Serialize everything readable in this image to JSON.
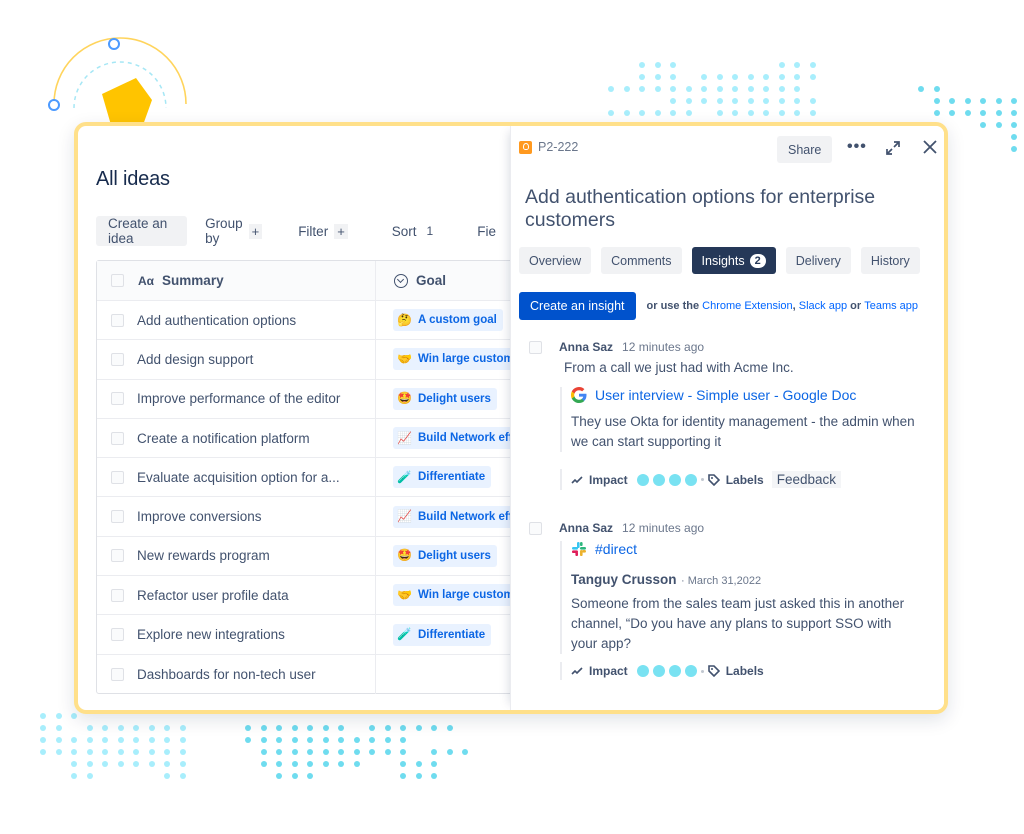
{
  "left_panel": {
    "title": "All ideas",
    "toolbar": {
      "create_label": "Create an idea",
      "group_by_label": "Group by",
      "group_by_add": "+",
      "filter_label": "Filter",
      "filter_add": "+",
      "sort_label": "Sort",
      "sort_count": "1",
      "fields_label": "Fie"
    },
    "table": {
      "columns": [
        {
          "icon": "text-type-icon",
          "icon_text": "Aα",
          "label": "Summary"
        },
        {
          "icon": "goal-icon",
          "label": "Goal"
        }
      ],
      "rows": [
        {
          "summary": "Add authentication options",
          "goal": "A custom goal",
          "goal_emoji": "🤔"
        },
        {
          "summary": "Add design support",
          "goal": "Win large customers",
          "goal_emoji": "🤝"
        },
        {
          "summary": "Improve performance of the editor",
          "goal": "Delight users",
          "goal_emoji": "🤩"
        },
        {
          "summary": "Create a notification platform",
          "goal": "Build Network effects",
          "goal_emoji": "📈"
        },
        {
          "summary": "Evaluate acquisition option for a...",
          "goal": "Differentiate",
          "goal_emoji": "🧪"
        },
        {
          "summary": "Improve conversions",
          "goal": "Build Network effects",
          "goal_emoji": "📈"
        },
        {
          "summary": "New rewards program",
          "goal": "Delight users",
          "goal_emoji": "🤩"
        },
        {
          "summary": "Refactor user profile data",
          "goal": "Win large customers",
          "goal_emoji": "🤝"
        },
        {
          "summary": "Explore new integrations",
          "goal": "Differentiate",
          "goal_emoji": "🧪"
        },
        {
          "summary": "Dashboards for non-tech user",
          "goal": "",
          "goal_emoji": ""
        }
      ]
    }
  },
  "detail_panel": {
    "issue_key": "P2-222",
    "issue_icon": "lightbulb-icon",
    "share_label": "Share",
    "more_label": "•••",
    "title": "Add authentication options for enterprise customers",
    "tabs": [
      {
        "label": "Overview",
        "active": false
      },
      {
        "label": "Comments",
        "active": false
      },
      {
        "label": "Insights",
        "active": true,
        "badge": "2"
      },
      {
        "label": "Delivery",
        "active": false
      },
      {
        "label": "History",
        "active": false
      }
    ],
    "create_insight_label": "Create an insight",
    "create_hint": {
      "prefix": "or use the",
      "link1": "Chrome Extension",
      "comma": ",",
      "link2": "Slack app",
      "or": "or",
      "link3": "Teams app"
    },
    "insights": [
      {
        "author": "Anna Saz",
        "time": "12 minutes ago",
        "note": "From a call we just had with Acme Inc.",
        "source_icon": "google-icon",
        "source_title": "User interview - Simple user - Google Doc",
        "quote": "They use Okta for identity management - the admin when we can start supporting it",
        "impact_label": "Impact",
        "impact_value": 4,
        "impact_max": 4,
        "labels_label": "Labels",
        "labels": [
          "Feedback"
        ]
      },
      {
        "author": "Anna Saz",
        "time": "12 minutes ago",
        "source_icon": "slack-icon",
        "source_title": "#direct",
        "message_author": "Tanguy Crusson",
        "message_date": "March 31,2022",
        "quote": "Someone from the sales team just asked this in another channel, “Do you have any plans to support SSO with your app?",
        "impact_label": "Impact",
        "impact_value": 4,
        "impact_max": 4,
        "labels_label": "Labels",
        "labels": []
      }
    ]
  },
  "colors": {
    "card_border": "#ffe08a",
    "accent_blue": "#0052cc",
    "active_tab": "#253858",
    "impact_dot": "#79e2f2",
    "goal_chip_bg": "#e9f2ff",
    "goal_chip_text": "#0c66e4",
    "pentagon": "#ffc400"
  }
}
